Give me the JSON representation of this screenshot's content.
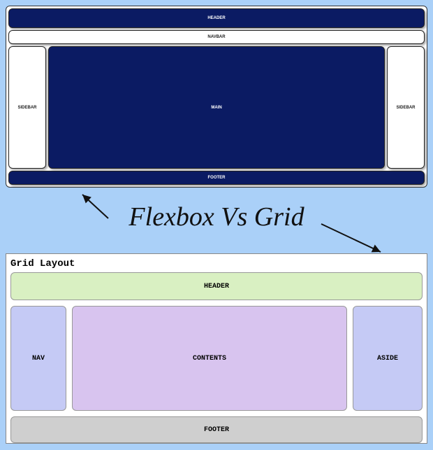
{
  "title": "Flexbox Vs Grid",
  "flexbox": {
    "header": "HEADER",
    "navbar": "NAVBAR",
    "sidebar_left": "SIDEBAR",
    "main": "MAIN",
    "sidebar_right": "SIDEBAR",
    "footer": "FOOTER"
  },
  "grid": {
    "title": "Grid Layout",
    "header": "HEADER",
    "nav": "NAV",
    "contents": "CONTENTS",
    "aside": "ASIDE",
    "footer": "FOOTER"
  }
}
